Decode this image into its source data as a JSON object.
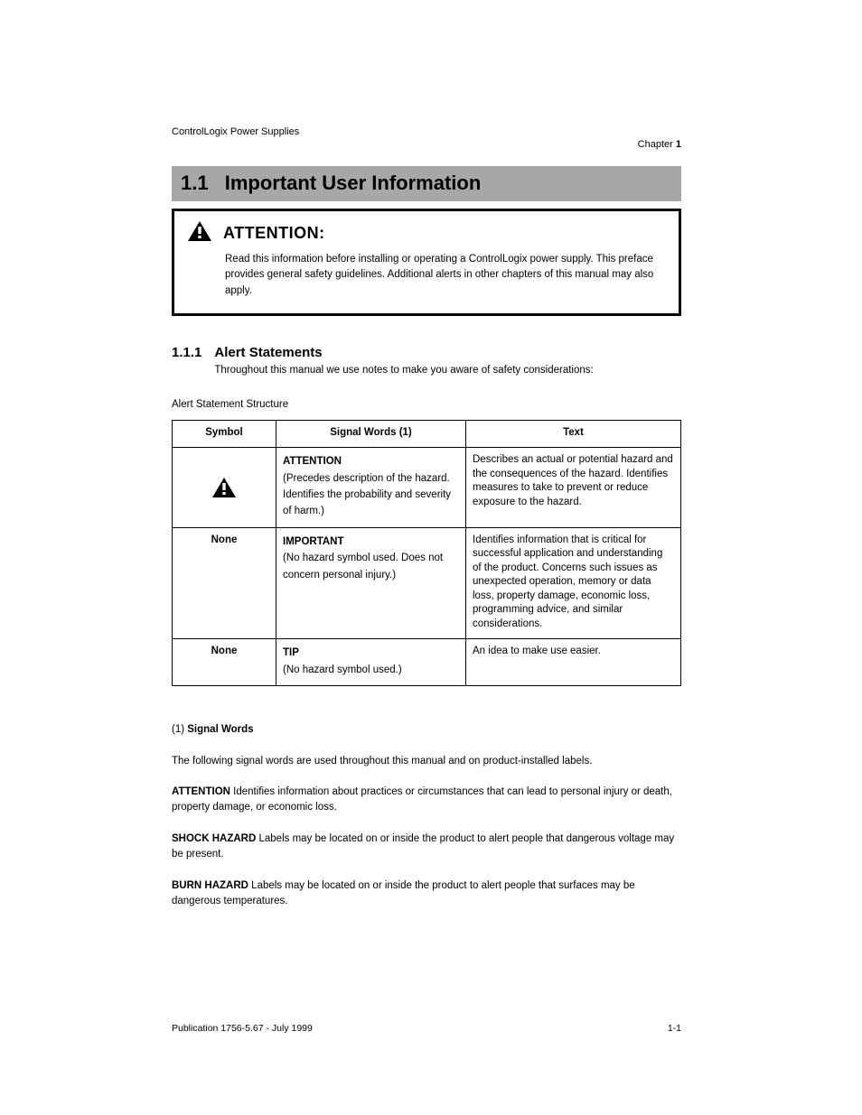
{
  "header": {
    "product": "ControlLogix Power Supplies",
    "chapter_label": "Chapter",
    "chapter_number": "1"
  },
  "section_bar": {
    "number": "1.1",
    "title": "Important User Information"
  },
  "attention": {
    "label": "ATTENTION:",
    "text": "Read this information before installing or operating a ControlLogix power supply. This preface provides general safety guidelines. Additional alerts in other chapters of this manual may also apply."
  },
  "subsection": {
    "number": "1.1.1",
    "title": "Alert Statements",
    "body": "Throughout this manual we use notes to make you aware of safety considerations:"
  },
  "table_caption": "Alert Statement Structure",
  "table": {
    "headers": [
      "Symbol",
      "Signal Words (1)",
      "Text"
    ],
    "rows": [
      {
        "symbol": "⚠",
        "signal_prefix": "ATTENTION",
        "signal_desc": "(Precedes description of the hazard. Identifies the probability and severity of harm.)",
        "text_desc": "Describes an actual or potential hazard and the consequences of the hazard. Identifies measures to take to prevent or reduce exposure to the hazard."
      },
      {
        "symbol": "",
        "signal_prefix": "IMPORTANT",
        "signal_desc": "(No hazard symbol used. Does not concern personal injury.)",
        "text_desc": "Identifies information that is critical for successful application and understanding of the product. Concerns such issues as unexpected operation, memory or data loss, property damage, economic loss, programming advice, and similar considerations."
      },
      {
        "symbol": "",
        "signal_prefix": "TIP",
        "signal_desc": "(No hazard symbol used.)",
        "text_desc": "An idea to make use easier."
      }
    ]
  },
  "signal_words_section": {
    "number": "(1)",
    "title": "Signal Words",
    "intro": "The following signal words are used throughout this manual and on product-installed labels.",
    "items": [
      {
        "word": "ATTENTION",
        "desc": "Identifies information about practices or circumstances that can lead to personal injury or death, property damage, or economic loss."
      },
      {
        "word": "SHOCK HAZARD",
        "desc": "Labels may be located on or inside the product to alert people that dangerous voltage may be present."
      },
      {
        "word": "BURN HAZARD",
        "desc": "Labels may be located on or inside the product to alert people that surfaces may be dangerous temperatures."
      }
    ]
  },
  "footer": {
    "publication": "Publication 1756-5.67 - July 1999",
    "page": "1-1"
  }
}
